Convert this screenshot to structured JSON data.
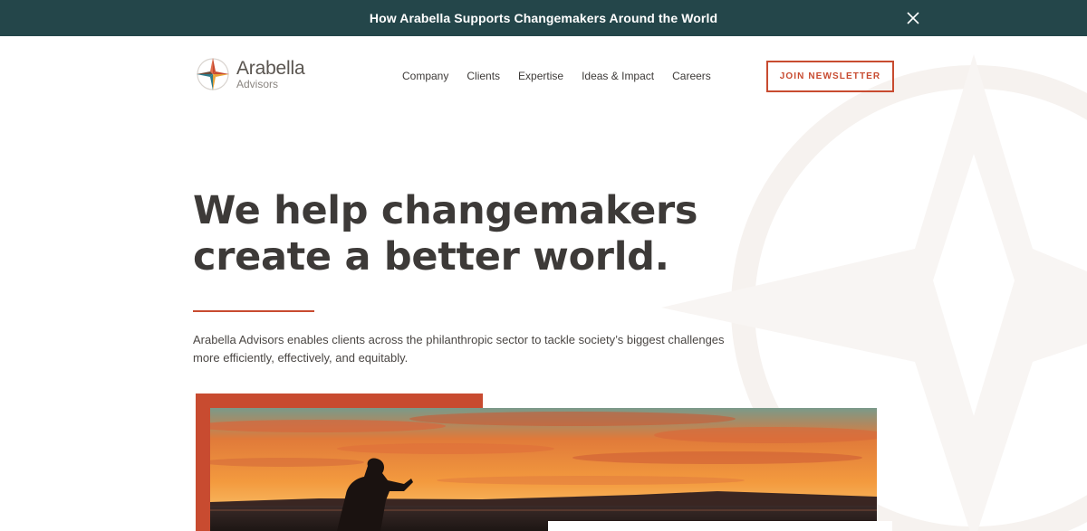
{
  "announcement": {
    "text": "How Arabella Supports Changemakers Around the World",
    "close_icon": "close-icon"
  },
  "logo": {
    "name": "Arabella",
    "sub": "Advisors",
    "icon": "compass-star-icon",
    "colors": [
      "#c84b30",
      "#2c7a8a",
      "#e8a23a",
      "#6b4a3a"
    ]
  },
  "nav": {
    "items": [
      "Company",
      "Clients",
      "Expertise",
      "Ideas & Impact",
      "Careers"
    ]
  },
  "cta": {
    "join_label": "JOIN NEWSLETTER"
  },
  "hero": {
    "title_line1": "We help changemakers",
    "title_line2": "create a better world.",
    "description": "Arabella Advisors enables clients across the philanthropic sector to tackle society’s biggest challenges more efficiently, effectively, and equitably."
  },
  "colors": {
    "accent": "#c84b30",
    "announce_bg": "#24464a",
    "text": "#3d3a38"
  }
}
